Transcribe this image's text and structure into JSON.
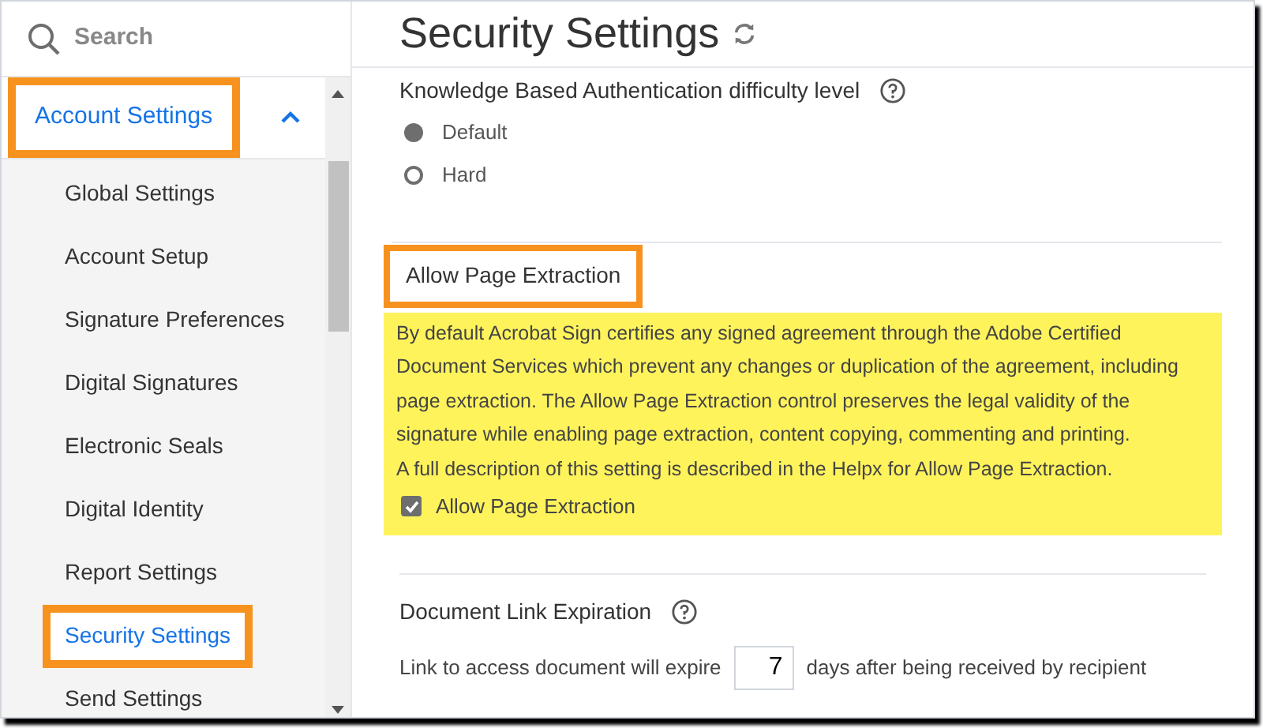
{
  "sidebar": {
    "search": {
      "placeholder": "Search"
    },
    "section": {
      "label": "Account Settings",
      "expanded": true,
      "highlighted": true
    },
    "items": [
      {
        "label": "Global Settings",
        "selected": false,
        "highlighted": false
      },
      {
        "label": "Account Setup",
        "selected": false,
        "highlighted": false
      },
      {
        "label": "Signature Preferences",
        "selected": false,
        "highlighted": false
      },
      {
        "label": "Digital Signatures",
        "selected": false,
        "highlighted": false
      },
      {
        "label": "Electronic Seals",
        "selected": false,
        "highlighted": false
      },
      {
        "label": "Digital Identity",
        "selected": false,
        "highlighted": false
      },
      {
        "label": "Report Settings",
        "selected": false,
        "highlighted": false
      },
      {
        "label": "Security Settings",
        "selected": true,
        "highlighted": true
      },
      {
        "label": "Send Settings",
        "selected": false,
        "highlighted": false
      }
    ]
  },
  "page": {
    "title": "Security Settings",
    "kba": {
      "label": "Knowledge Based Authentication difficulty level",
      "options": [
        {
          "label": "Default",
          "selected": true
        },
        {
          "label": "Hard",
          "selected": false
        }
      ]
    },
    "extraction": {
      "heading": "Allow Page Extraction",
      "heading_highlighted": true,
      "highlighted": true,
      "description": "By default Acrobat Sign certifies any signed agreement through the Adobe Certified Document Services which prevent any changes or duplication of the agreement, including page extraction. The Allow Page Extraction control preserves the legal validity of the signature while enabling page extraction, content copying, commenting and printing.",
      "note": "A full description of this setting is described in the Helpx for Allow Page Extraction.",
      "checkbox": {
        "label": "Allow Page Extraction",
        "checked": true
      }
    },
    "expiration": {
      "heading": "Document Link Expiration",
      "before": "Link to access document will expire",
      "value": "7",
      "after": "days after being received by recipient"
    }
  }
}
